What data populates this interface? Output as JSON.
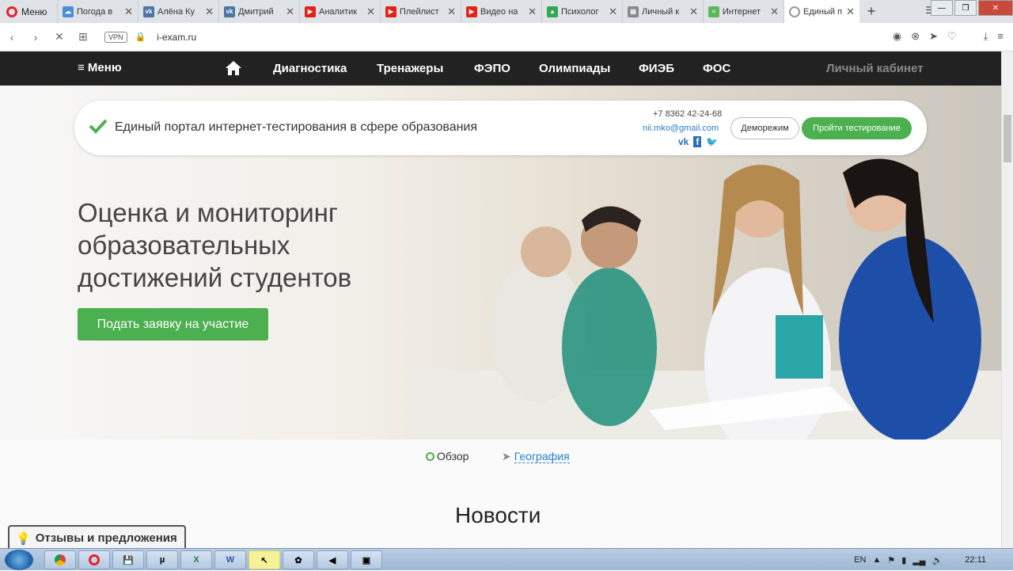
{
  "browser": {
    "menu_label": "Меню",
    "tabs": [
      {
        "label": "Погода в",
        "color": "#4a90d9"
      },
      {
        "label": "Алёна Ку",
        "color": "#4c75a3"
      },
      {
        "label": "Дмитрий",
        "color": "#4c75a3"
      },
      {
        "label": "Аналитик",
        "color": "#e62117"
      },
      {
        "label": "Плейлист",
        "color": "#e62117"
      },
      {
        "label": "Видео на",
        "color": "#e62117"
      },
      {
        "label": "Психолог",
        "color": "#34a853"
      },
      {
        "label": "Личный к",
        "color": "#888888"
      },
      {
        "label": "Интернет",
        "color": "#5cb85c"
      }
    ],
    "active_tab": "Единый п",
    "vpn_label": "VPN",
    "url": "i-exam.ru"
  },
  "sitenav": {
    "menu": "≡ Меню",
    "items": [
      "Диагностика",
      "Тренажеры",
      "ФЭПО",
      "Олимпиады",
      "ФИЭБ",
      "ФОС"
    ],
    "cabinet": "Личный кабинет"
  },
  "infocard": {
    "text": "Единый портал интернет-тестирования в сфере образования",
    "phone": "+7 8362 42-24-68",
    "email": "nii.mko@gmail.com",
    "demo_label": "Деморежим",
    "test_label": "Пройти тестирование"
  },
  "hero": {
    "line1": "Оценка и мониторинг",
    "line2": "образовательных",
    "line3": "достижений студентов",
    "apply_label": "Подать заявку на участие"
  },
  "tabs": {
    "overview": "Обзор",
    "geography": "География"
  },
  "news_title": "Новости",
  "feedback_label": "Отзывы и предложения",
  "taskbar": {
    "lang": "EN",
    "time": "22:11"
  },
  "colors": {
    "accent_green": "#4caf50",
    "nav_dark": "#222222",
    "link_blue": "#2a7fcf"
  }
}
